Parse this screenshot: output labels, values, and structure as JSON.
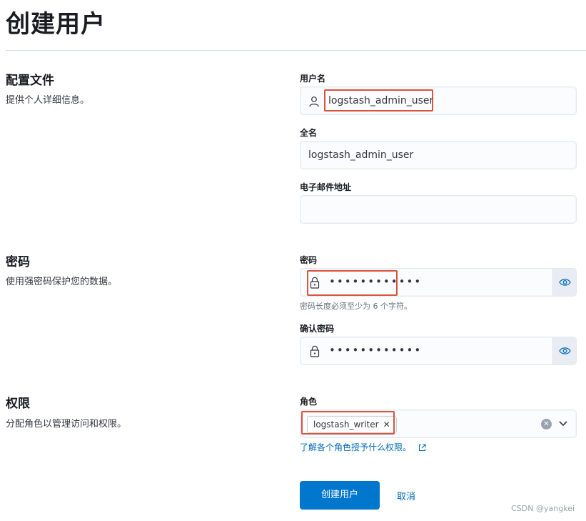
{
  "page": {
    "title": "创建用户"
  },
  "sections": {
    "profile": {
      "title": "配置文件",
      "description": "提供个人详细信息。"
    },
    "password": {
      "title": "密码",
      "description": "使用强密码保护您的数据。"
    },
    "privileges": {
      "title": "权限",
      "description": "分配角色以管理访问和权限。"
    }
  },
  "form": {
    "username": {
      "label": "用户名",
      "value": "logstash_admin_user"
    },
    "full_name": {
      "label": "全名",
      "value": "logstash_admin_user"
    },
    "email": {
      "label": "电子邮件地址",
      "value": ""
    },
    "password": {
      "label": "密码",
      "masked": "••••••••••••",
      "help": "密码长度必须至少为 6 个字符。"
    },
    "confirm_password": {
      "label": "确认密码",
      "masked": "••••••••••••"
    },
    "roles": {
      "label": "角色",
      "selected": [
        "logstash_writer"
      ],
      "remove_glyph": "✕",
      "clear_glyph": "✕",
      "help_link": "了解各个角色授予什么权限。"
    }
  },
  "actions": {
    "create_label": "创建用户",
    "cancel_label": "取消"
  },
  "watermark": "CSDN @yangkei",
  "icons": {
    "user": "user-icon",
    "lock": "lock-icon",
    "eye": "eye-icon",
    "chevron": "chevron-down-icon",
    "external": "external-link-icon"
  },
  "colors": {
    "primary": "#0077cc",
    "link": "#006bb8",
    "highlight": "#d9533d"
  }
}
